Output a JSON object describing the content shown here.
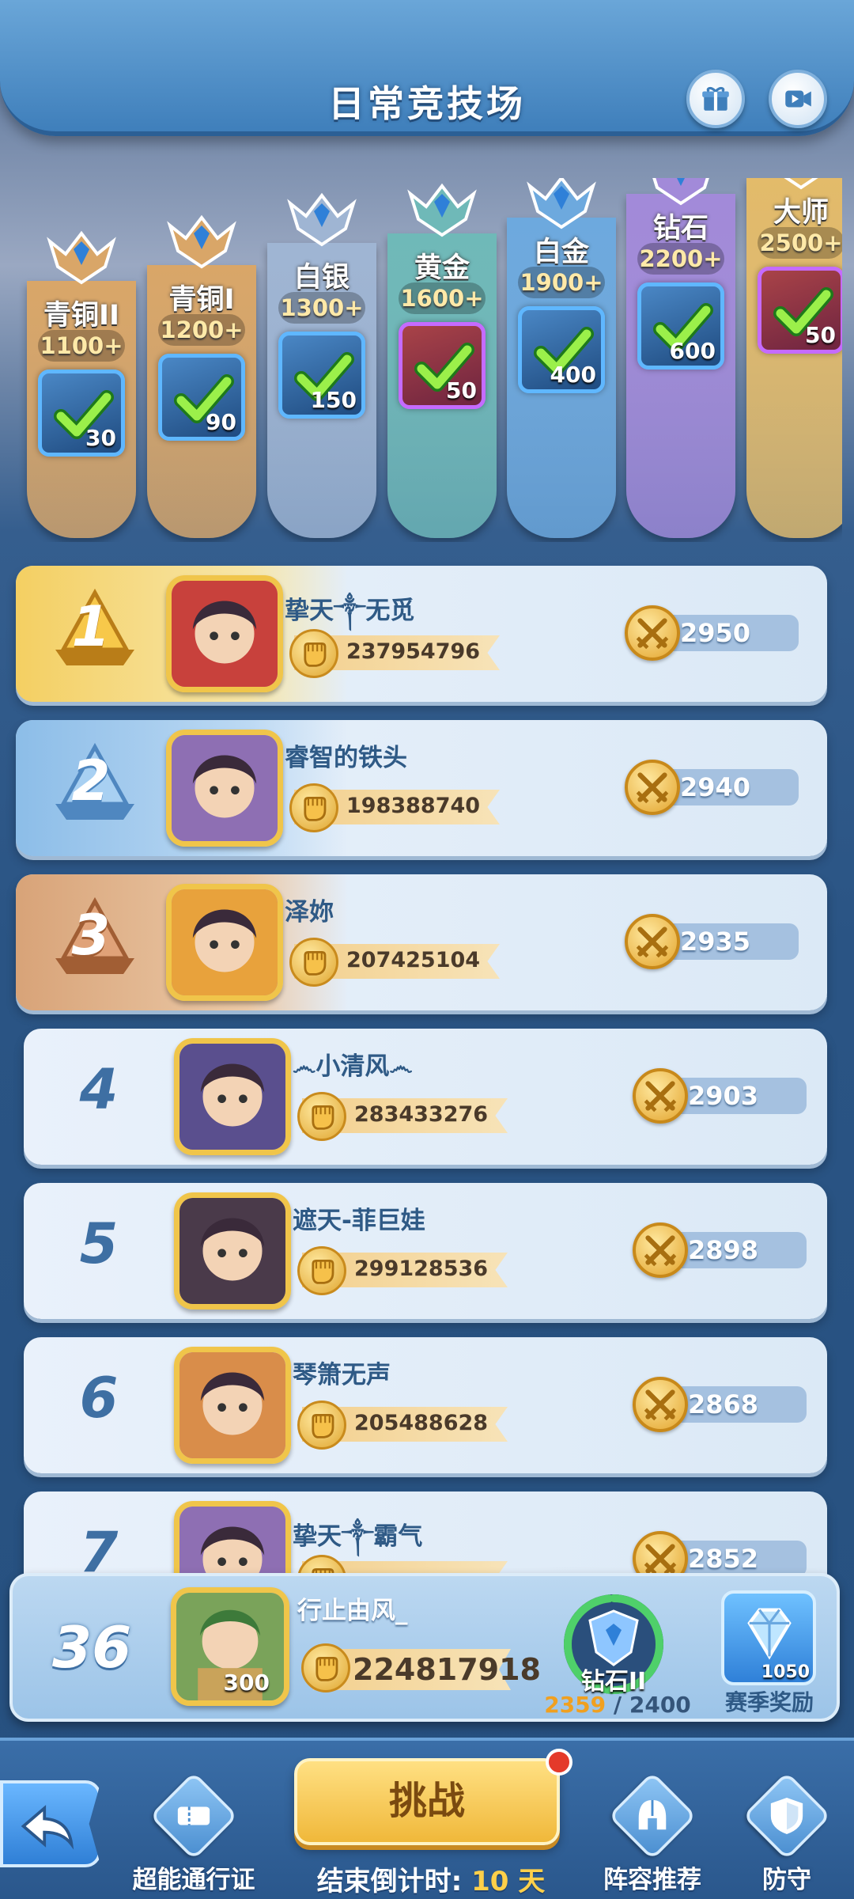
{
  "header": {
    "title": "日常竞技场",
    "gift_icon": "gift-icon",
    "video_icon": "video-icon"
  },
  "tiers": [
    {
      "name": "青铜II",
      "threshold": "1100+",
      "reward_count": "30",
      "color": "#d9a668",
      "reward_style": "blue",
      "claimed": true
    },
    {
      "name": "青铜I",
      "threshold": "1200+",
      "reward_count": "90",
      "color": "#d9a668",
      "reward_style": "blue",
      "claimed": true
    },
    {
      "name": "白银",
      "threshold": "1300+",
      "reward_count": "150",
      "color": "#9fb5d3",
      "reward_style": "blue",
      "claimed": true
    },
    {
      "name": "黄金",
      "threshold": "1600+",
      "reward_count": "50",
      "color": "#6fb9b8",
      "reward_style": "purple",
      "claimed": true
    },
    {
      "name": "白金",
      "threshold": "1900+",
      "reward_count": "400",
      "color": "#6da9de",
      "reward_style": "blue",
      "claimed": true
    },
    {
      "name": "钻石",
      "threshold": "2200+",
      "reward_count": "600",
      "color": "#a28ad9",
      "reward_style": "blue",
      "claimed": true
    },
    {
      "name": "大师",
      "threshold": "2500+",
      "reward_count": "50",
      "color": "#e3bb6a",
      "reward_style": "purple",
      "claimed": true
    }
  ],
  "rankings": [
    {
      "rank": "1",
      "name": "挚天༒无觅",
      "power": "237954796",
      "score": "2950",
      "avatar_color": "#c8413c"
    },
    {
      "rank": "2",
      "name": "睿智的铁头",
      "power": "198388740",
      "score": "2940",
      "avatar_color": "#8e6fb3"
    },
    {
      "rank": "3",
      "name": "泽妳",
      "power": "207425104",
      "score": "2935",
      "avatar_color": "#e8a23c"
    },
    {
      "rank": "4",
      "name": "෴小清风෴",
      "power": "283433276",
      "score": "2903",
      "avatar_color": "#5a4f8e"
    },
    {
      "rank": "5",
      "name": "遮天-菲巨娃",
      "power": "299128536",
      "score": "2898",
      "avatar_color": "#4a3a4a"
    },
    {
      "rank": "6",
      "name": "琴箫无声",
      "power": "205488628",
      "score": "2868",
      "avatar_color": "#d98d4a"
    },
    {
      "rank": "7",
      "name": "挚天༒霸气",
      "power": "",
      "score": "2852",
      "avatar_color": "#8e6fb3"
    }
  ],
  "me": {
    "rank": "36",
    "name": "行止由风_",
    "level": "300",
    "power": "224817918",
    "tier_name": "钻石II",
    "tier_progress_current": "2359",
    "tier_progress_separator": " / ",
    "tier_progress_max": "2400",
    "tier_progress_fraction": 0.983,
    "season_reward_label": "赛季奖励",
    "season_reward_count": "1050"
  },
  "bottom": {
    "back_icon": "back-arrow-icon",
    "pass_label": "超能通行证",
    "challenge_label": "挑战",
    "countdown_label": "结束倒计时:",
    "countdown_value": "10 天",
    "lineup_label": "阵容推荐",
    "defense_label": "防守"
  },
  "colors": {
    "accent": "#f0b83a",
    "primary": "#3f7fbb",
    "text": "#2f5a86"
  }
}
